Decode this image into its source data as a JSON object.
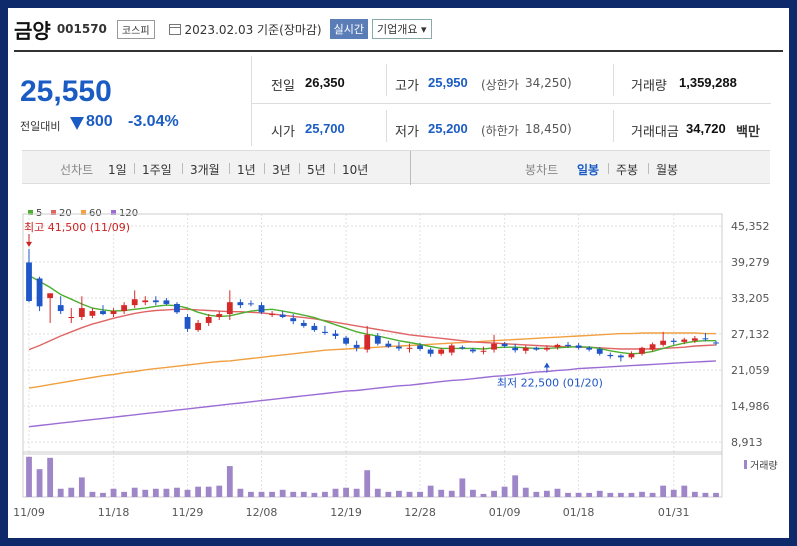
{
  "header": {
    "name": "금양",
    "code": "001570",
    "market": "코스피",
    "date_text": "2023.02.03 기준(장마감)",
    "realtime_label": "실시간",
    "overview_label": "기업개요 ▾"
  },
  "price": {
    "current": "25,550",
    "change_label": "전일대비",
    "change": "800",
    "change_pct": "-3.04%"
  },
  "stats": {
    "prev_close_label": "전일",
    "prev_close": "26,350",
    "high_label": "고가",
    "high": "25,950",
    "upper_limit_label": "(상한가",
    "upper_limit": "34,250)",
    "volume_label": "거래량",
    "volume": "1,359,288",
    "open_label": "시가",
    "open": "25,700",
    "low_label": "저가",
    "low": "25,200",
    "lower_limit_label": "(하한가",
    "lower_limit": "18,450)",
    "turnover_label": "거래대금",
    "turnover": "34,720",
    "turnover_unit": "백만"
  },
  "period_bar": {
    "line_chart_label": "선차트",
    "periods": [
      "1일",
      "1주일",
      "3개월",
      "1년",
      "3년",
      "5년",
      "10년"
    ],
    "candle_label": "봉차트",
    "candle_periods": [
      "일봉",
      "주봉",
      "월봉"
    ],
    "candle_active": "일봉"
  },
  "colors": {
    "up": "#d62a2a",
    "down": "#1f56c8",
    "ma5": "#4caf30",
    "ma20": "#e06464",
    "ma60": "#f0a040",
    "ma120": "#9c6cd6",
    "volume": "#9e86c8",
    "price_blue": "#1b5cc4"
  },
  "chart_data": {
    "type": "candlestick",
    "legend": [
      "5",
      "20",
      "60",
      "120"
    ],
    "y_ticks": [
      "45,352",
      "39,279",
      "33,205",
      "27,132",
      "21,059",
      "14,986",
      "8,913"
    ],
    "ylim": [
      8913,
      45352
    ],
    "x_ticks": [
      "11/09",
      "11/18",
      "11/29",
      "12/08",
      "12/19",
      "12/28",
      "01/09",
      "01/18",
      "01/31"
    ],
    "volume_label": "거래량",
    "annotations": {
      "max_label": "최고 41,500 (11/09)",
      "min_label": "최저 22,500 (01/20)",
      "max_value": 41500,
      "min_value": 22500,
      "max_index": 0,
      "min_index": 49
    },
    "candles": [
      {
        "o": 39200,
        "h": 41500,
        "l": 32500,
        "c": 32700
      },
      {
        "o": 36500,
        "h": 36800,
        "l": 31000,
        "c": 31800
      },
      {
        "o": 33200,
        "h": 34000,
        "l": 29000,
        "c": 34000
      },
      {
        "o": 32000,
        "h": 33500,
        "l": 30500,
        "c": 31000
      },
      {
        "o": 30000,
        "h": 31500,
        "l": 29000,
        "c": 30000
      },
      {
        "o": 30000,
        "h": 33500,
        "l": 29500,
        "c": 31500
      },
      {
        "o": 30200,
        "h": 31500,
        "l": 29800,
        "c": 31000
      },
      {
        "o": 31000,
        "h": 32000,
        "l": 30300,
        "c": 30500
      },
      {
        "o": 30500,
        "h": 31500,
        "l": 30000,
        "c": 31000
      },
      {
        "o": 31000,
        "h": 32500,
        "l": 30500,
        "c": 32000
      },
      {
        "o": 32000,
        "h": 34500,
        "l": 31500,
        "c": 33000
      },
      {
        "o": 32500,
        "h": 33500,
        "l": 32000,
        "c": 32800
      },
      {
        "o": 32800,
        "h": 33500,
        "l": 32000,
        "c": 32500
      },
      {
        "o": 32800,
        "h": 33200,
        "l": 32000,
        "c": 32200
      },
      {
        "o": 32200,
        "h": 32500,
        "l": 30500,
        "c": 30800
      },
      {
        "o": 30000,
        "h": 30500,
        "l": 27500,
        "c": 28000
      },
      {
        "o": 27800,
        "h": 29500,
        "l": 27500,
        "c": 29000
      },
      {
        "o": 29000,
        "h": 30500,
        "l": 28500,
        "c": 30000
      },
      {
        "o": 30000,
        "h": 31000,
        "l": 29500,
        "c": 30500
      },
      {
        "o": 30500,
        "h": 34500,
        "l": 29500,
        "c": 32500
      },
      {
        "o": 32500,
        "h": 33000,
        "l": 31500,
        "c": 32000
      },
      {
        "o": 32300,
        "h": 32800,
        "l": 31800,
        "c": 32200
      },
      {
        "o": 32000,
        "h": 32500,
        "l": 30500,
        "c": 30800
      },
      {
        "o": 30500,
        "h": 31000,
        "l": 30000,
        "c": 30500
      },
      {
        "o": 30400,
        "h": 31000,
        "l": 29800,
        "c": 30000
      },
      {
        "o": 29800,
        "h": 30500,
        "l": 28800,
        "c": 29300
      },
      {
        "o": 29000,
        "h": 29500,
        "l": 28200,
        "c": 28500
      },
      {
        "o": 28500,
        "h": 29000,
        "l": 27500,
        "c": 27800
      },
      {
        "o": 27500,
        "h": 28500,
        "l": 27000,
        "c": 27300
      },
      {
        "o": 27200,
        "h": 27800,
        "l": 26300,
        "c": 26800
      },
      {
        "o": 26500,
        "h": 26800,
        "l": 25200,
        "c": 25500
      },
      {
        "o": 25300,
        "h": 26000,
        "l": 24200,
        "c": 24800
      },
      {
        "o": 24500,
        "h": 28500,
        "l": 24000,
        "c": 27000
      },
      {
        "o": 26800,
        "h": 27300,
        "l": 25200,
        "c": 25500
      },
      {
        "o": 25500,
        "h": 26000,
        "l": 24800,
        "c": 25000
      },
      {
        "o": 25000,
        "h": 25800,
        "l": 24300,
        "c": 24700
      },
      {
        "o": 24700,
        "h": 25500,
        "l": 24000,
        "c": 24800
      },
      {
        "o": 25200,
        "h": 25600,
        "l": 24300,
        "c": 24600
      },
      {
        "o": 24500,
        "h": 24800,
        "l": 23300,
        "c": 23800
      },
      {
        "o": 23800,
        "h": 24800,
        "l": 23500,
        "c": 24500
      },
      {
        "o": 24000,
        "h": 25500,
        "l": 23500,
        "c": 25200
      },
      {
        "o": 24900,
        "h": 25200,
        "l": 24500,
        "c": 24700
      },
      {
        "o": 24500,
        "h": 24800,
        "l": 23900,
        "c": 24200
      },
      {
        "o": 24300,
        "h": 25000,
        "l": 23700,
        "c": 24300
      },
      {
        "o": 24500,
        "h": 27000,
        "l": 24000,
        "c": 25500
      },
      {
        "o": 25500,
        "h": 25800,
        "l": 24800,
        "c": 25100
      },
      {
        "o": 24800,
        "h": 25500,
        "l": 24000,
        "c": 24400
      },
      {
        "o": 24300,
        "h": 25200,
        "l": 23800,
        "c": 24800
      },
      {
        "o": 24800,
        "h": 25000,
        "l": 24300,
        "c": 24500
      },
      {
        "o": 24500,
        "h": 25200,
        "l": 24200,
        "c": 24800
      },
      {
        "o": 24900,
        "h": 25500,
        "l": 24500,
        "c": 25300
      },
      {
        "o": 25300,
        "h": 25800,
        "l": 24800,
        "c": 25100
      },
      {
        "o": 25200,
        "h": 25600,
        "l": 24500,
        "c": 24800
      },
      {
        "o": 24800,
        "h": 25100,
        "l": 24200,
        "c": 24500
      },
      {
        "o": 24600,
        "h": 24900,
        "l": 23500,
        "c": 23800
      },
      {
        "o": 23600,
        "h": 24000,
        "l": 23000,
        "c": 23400
      },
      {
        "o": 23500,
        "h": 23700,
        "l": 22500,
        "c": 23200
      },
      {
        "o": 23200,
        "h": 24200,
        "l": 22900,
        "c": 23800
      },
      {
        "o": 23800,
        "h": 25000,
        "l": 23500,
        "c": 24800
      },
      {
        "o": 24500,
        "h": 25700,
        "l": 24200,
        "c": 25400
      },
      {
        "o": 25300,
        "h": 27500,
        "l": 25000,
        "c": 26000
      },
      {
        "o": 26000,
        "h": 26400,
        "l": 25300,
        "c": 25800
      },
      {
        "o": 25800,
        "h": 26500,
        "l": 25400,
        "c": 26200
      },
      {
        "o": 26000,
        "h": 26800,
        "l": 25600,
        "c": 26400
      },
      {
        "o": 26400,
        "h": 27300,
        "l": 25900,
        "c": 26300
      },
      {
        "o": 25700,
        "h": 26000,
        "l": 25200,
        "c": 25550
      }
    ],
    "ma5": [
      37000,
      36000,
      35000,
      33800,
      33000,
      32200,
      31500,
      31200,
      31000,
      31100,
      31300,
      31500,
      31800,
      32000,
      31900,
      31500,
      30800,
      30300,
      30100,
      30200,
      30600,
      31000,
      31200,
      31300,
      31000,
      30700,
      30300,
      29900,
      29300,
      28700,
      28100,
      27500,
      27100,
      26800,
      26400,
      26000,
      25700,
      25400,
      25000,
      24700,
      24700,
      24700,
      24700,
      24600,
      24800,
      24900,
      24900,
      24800,
      24700,
      24700,
      24800,
      24900,
      25000,
      24900,
      24700,
      24300,
      24000,
      23800,
      23900,
      24200,
      24700,
      25200,
      25600,
      25900,
      26000,
      26000
    ],
    "ma20": [
      24500,
      25200,
      26000,
      26800,
      27500,
      28200,
      28800,
      29300,
      29800,
      30200,
      30600,
      30900,
      31100,
      31200,
      31300,
      31300,
      31200,
      31100,
      31000,
      30900,
      30900,
      30800,
      30700,
      30500,
      30300,
      30100,
      29900,
      29700,
      29400,
      29100,
      28800,
      28500,
      28200,
      27900,
      27600,
      27300,
      27000,
      26800,
      26600,
      26400,
      26200,
      26000,
      25800,
      25700,
      25600,
      25500,
      25400,
      25300,
      25200,
      25100,
      25000,
      25000,
      24900,
      24900,
      24800,
      24700,
      24600,
      24600,
      24600,
      24600,
      24700,
      24800,
      24900,
      25100,
      25200,
      25300
    ],
    "ma60": [
      18000,
      18300,
      18600,
      18900,
      19200,
      19500,
      19800,
      20100,
      20300,
      20600,
      20800,
      21100,
      21300,
      21500,
      21700,
      21900,
      22100,
      22300,
      22500,
      22600,
      22800,
      23000,
      23200,
      23400,
      23600,
      23800,
      24000,
      24200,
      24400,
      24500,
      24600,
      24700,
      24800,
      24900,
      25000,
      25100,
      25200,
      25300,
      25400,
      25500,
      25600,
      25700,
      25800,
      25900,
      26000,
      26100,
      26200,
      26300,
      26400,
      26500,
      26600,
      26700,
      26800,
      26900,
      27000,
      27100,
      27200,
      27200,
      27300,
      27300,
      27300,
      27300,
      27300,
      27300,
      27200,
      27200
    ],
    "ma120": [
      11500,
      11700,
      11900,
      12100,
      12300,
      12500,
      12700,
      12900,
      13100,
      13300,
      13500,
      13700,
      13900,
      14100,
      14300,
      14500,
      14700,
      14900,
      15100,
      15300,
      15500,
      15700,
      15900,
      16100,
      16300,
      16500,
      16700,
      16900,
      17100,
      17300,
      17500,
      17600,
      17800,
      18000,
      18200,
      18400,
      18500,
      18700,
      18900,
      19100,
      19300,
      19400,
      19600,
      19800,
      20000,
      20100,
      20300,
      20500,
      20700,
      20800,
      21000,
      21100,
      21300,
      21400,
      21500,
      21600,
      21700,
      21800,
      21900,
      22000,
      22100,
      22200,
      22300,
      22400,
      22500,
      22600
    ],
    "volumes": [
      3900000,
      2700000,
      3800000,
      800000,
      900000,
      1900000,
      500000,
      400000,
      800000,
      500000,
      900000,
      700000,
      800000,
      800000,
      900000,
      700000,
      1000000,
      1000000,
      1100000,
      3000000,
      800000,
      500000,
      500000,
      500000,
      700000,
      500000,
      500000,
      400000,
      500000,
      800000,
      900000,
      800000,
      2600000,
      800000,
      500000,
      600000,
      500000,
      500000,
      1100000,
      700000,
      600000,
      1800000,
      700000,
      300000,
      600000,
      1000000,
      2100000,
      900000,
      500000,
      600000,
      800000,
      400000,
      400000,
      400000,
      600000,
      400000,
      400000,
      400000,
      500000,
      400000,
      1100000,
      700000,
      1100000,
      500000,
      400000,
      400000
    ]
  }
}
